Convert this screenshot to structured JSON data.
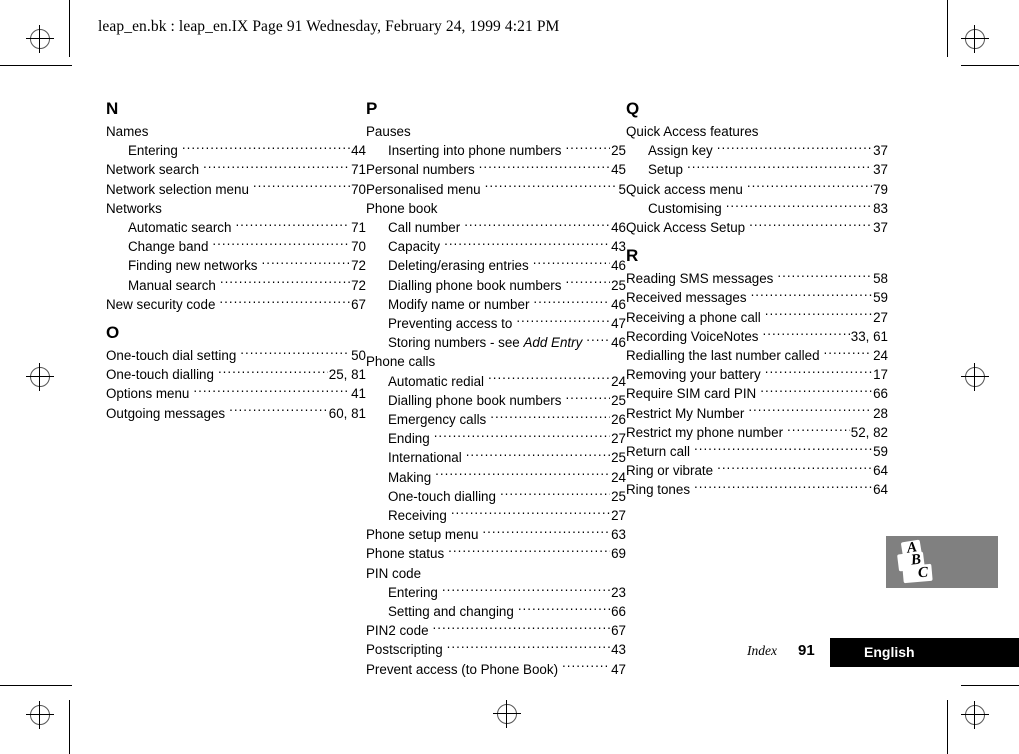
{
  "header": {
    "slug": "leap_en.bk : leap_en.IX  Page 91  Wednesday, February 24, 1999  4:21 PM"
  },
  "footer": {
    "index_label": "Index",
    "page_number": "91",
    "language": "English"
  },
  "logo": {
    "name": "abc-logo",
    "letters": [
      "A",
      "B",
      "C"
    ],
    "background_color": "#808080"
  },
  "columns": [
    {
      "id": "column-1",
      "sections": [
        {
          "letter": "N",
          "entries": [
            {
              "text": "Names",
              "page": "",
              "level": 1,
              "leader": false
            },
            {
              "text": "Entering",
              "page": "44",
              "level": 2,
              "leader": true
            },
            {
              "text": "Network search",
              "page": "71",
              "level": 1,
              "leader": true
            },
            {
              "text": "Network selection menu",
              "page": "70",
              "level": 1,
              "leader": true
            },
            {
              "text": "Networks",
              "page": "",
              "level": 1,
              "leader": false
            },
            {
              "text": "Automatic search",
              "page": "71",
              "level": 2,
              "leader": true
            },
            {
              "text": "Change band",
              "page": "70",
              "level": 2,
              "leader": true
            },
            {
              "text": "Finding new networks",
              "page": "72",
              "level": 2,
              "leader": true
            },
            {
              "text": "Manual search",
              "page": "72",
              "level": 2,
              "leader": true
            },
            {
              "text": "New security code",
              "page": "67",
              "level": 1,
              "leader": true
            }
          ]
        },
        {
          "letter": "O",
          "entries": [
            {
              "text": "One-touch dial setting",
              "page": "50",
              "level": 1,
              "leader": true
            },
            {
              "text": "One-touch dialling",
              "page": "25, 81",
              "level": 1,
              "leader": true
            },
            {
              "text": "Options menu",
              "page": "41",
              "level": 1,
              "leader": true
            },
            {
              "text": "Outgoing messages",
              "page": "60, 81",
              "level": 1,
              "leader": true
            }
          ]
        }
      ]
    },
    {
      "id": "column-2",
      "sections": [
        {
          "letter": "P",
          "entries": [
            {
              "text": "Pauses",
              "page": "",
              "level": 1,
              "leader": false
            },
            {
              "text": "Inserting into phone numbers",
              "page": "25",
              "level": 2,
              "leader": true
            },
            {
              "text": "Personal numbers",
              "page": "45",
              "level": 1,
              "leader": true
            },
            {
              "text": "Personalised menu",
              "page": "5",
              "level": 1,
              "leader": true
            },
            {
              "text": "Phone book",
              "page": "",
              "level": 1,
              "leader": false
            },
            {
              "text": "Call number",
              "page": "46",
              "level": 2,
              "leader": true
            },
            {
              "text": "Capacity",
              "page": "43",
              "level": 2,
              "leader": true
            },
            {
              "text": "Deleting/erasing entries",
              "page": "46",
              "level": 2,
              "leader": true
            },
            {
              "text": "Dialling phone book numbers",
              "page": "25",
              "level": 2,
              "leader": true
            },
            {
              "text": "Modify name or number",
              "page": "46",
              "level": 2,
              "leader": true
            },
            {
              "text": "Preventing access to",
              "page": "47",
              "level": 2,
              "leader": true
            },
            {
              "text": "Storing numbers - see ",
              "text_italic": "Add Entry",
              "page": "46",
              "level": 2,
              "leader": true
            },
            {
              "text": "Phone calls",
              "page": "",
              "level": 1,
              "leader": false
            },
            {
              "text": "Automatic redial",
              "page": "24",
              "level": 2,
              "leader": true
            },
            {
              "text": "Dialling phone book numbers",
              "page": "25",
              "level": 2,
              "leader": true
            },
            {
              "text": "Emergency calls",
              "page": "26",
              "level": 2,
              "leader": true
            },
            {
              "text": "Ending",
              "page": "27",
              "level": 2,
              "leader": true
            },
            {
              "text": "International",
              "page": "25",
              "level": 2,
              "leader": true
            },
            {
              "text": "Making",
              "page": "24",
              "level": 2,
              "leader": true
            },
            {
              "text": "One-touch dialling",
              "page": "25",
              "level": 2,
              "leader": true
            },
            {
              "text": "Receiving",
              "page": "27",
              "level": 2,
              "leader": true
            },
            {
              "text": "Phone setup menu",
              "page": "63",
              "level": 1,
              "leader": true
            },
            {
              "text": "Phone status",
              "page": "69",
              "level": 1,
              "leader": true
            },
            {
              "text": "PIN code",
              "page": "",
              "level": 1,
              "leader": false
            },
            {
              "text": "Entering",
              "page": "23",
              "level": 2,
              "leader": true
            },
            {
              "text": "Setting and changing",
              "page": "66",
              "level": 2,
              "leader": true
            },
            {
              "text": "PIN2 code",
              "page": "67",
              "level": 1,
              "leader": true
            },
            {
              "text": "Postscripting",
              "page": "43",
              "level": 1,
              "leader": true
            },
            {
              "text": "Prevent access (to Phone Book)",
              "page": "47",
              "level": 1,
              "leader": true
            }
          ]
        }
      ]
    },
    {
      "id": "column-3",
      "sections": [
        {
          "letter": "Q",
          "entries": [
            {
              "text": "Quick Access features",
              "page": "",
              "level": 1,
              "leader": false
            },
            {
              "text": "Assign key",
              "page": "37",
              "level": 2,
              "leader": true
            },
            {
              "text": "Setup",
              "page": "37",
              "level": 2,
              "leader": true
            },
            {
              "text": "Quick access menu",
              "page": "79",
              "level": 1,
              "leader": true
            },
            {
              "text": "Customising",
              "page": "83",
              "level": 2,
              "leader": true
            },
            {
              "text": "Quick Access Setup",
              "page": "37",
              "level": 1,
              "leader": true
            }
          ]
        },
        {
          "letter": "R",
          "entries": [
            {
              "text": "Reading SMS messages",
              "page": "58",
              "level": 1,
              "leader": true
            },
            {
              "text": "Received messages",
              "page": "59",
              "level": 1,
              "leader": true
            },
            {
              "text": "Receiving a phone call",
              "page": "27",
              "level": 1,
              "leader": true
            },
            {
              "text": "Recording VoiceNotes",
              "page": "33, 61",
              "level": 1,
              "leader": true
            },
            {
              "text": "Redialling the last number called",
              "page": "24",
              "level": 1,
              "leader": true
            },
            {
              "text": "Removing your battery",
              "page": "17",
              "level": 1,
              "leader": true
            },
            {
              "text": "Require SIM card PIN",
              "page": "66",
              "level": 1,
              "leader": true
            },
            {
              "text": "Restrict My Number",
              "page": "28",
              "level": 1,
              "leader": true
            },
            {
              "text": "Restrict my phone number",
              "page": "52, 82",
              "level": 1,
              "leader": true
            },
            {
              "text": "Return call",
              "page": "59",
              "level": 1,
              "leader": true
            },
            {
              "text": "Ring or vibrate",
              "page": "64",
              "level": 1,
              "leader": true
            },
            {
              "text": "Ring tones",
              "page": "64",
              "level": 1,
              "leader": true
            }
          ]
        }
      ]
    }
  ]
}
